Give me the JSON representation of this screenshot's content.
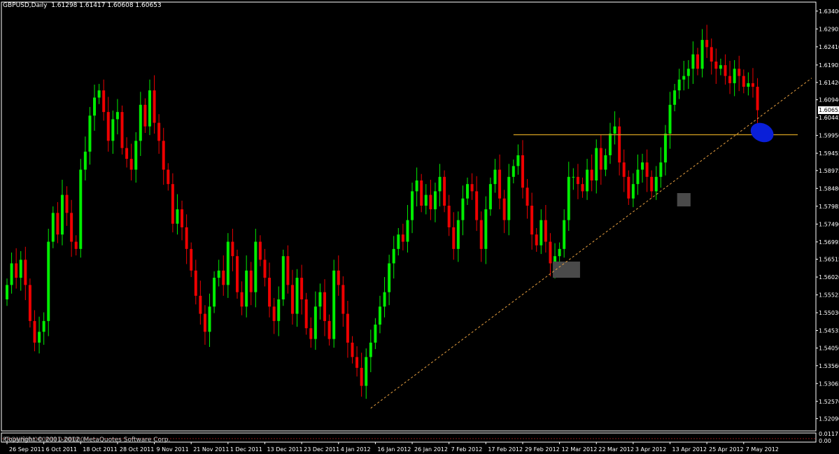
{
  "header": {
    "symbol": "GBPUSD,Daily",
    "ohlc": "1.61298 1.61417 1.60608 1.60653"
  },
  "subwindow": {
    "label": "Copyright © 2001-2012, MetaQuotes Software Corp.",
    "ghost_label": "PRONN(0.00003) 0.00000",
    "axis_top": "0.0117",
    "axis_bottom": "0.00"
  },
  "colors": {
    "background": "#000000",
    "bull": "#00ee00",
    "bear": "#ee0000",
    "axis": "#ffffff",
    "support_line": "#c8961e",
    "trend_line": "#e8a040",
    "marker": "#0a1fd8",
    "zone": "#4a4a4a"
  },
  "chart_data": {
    "type": "candlestick",
    "symbol": "GBPUSD",
    "timeframe": "Daily",
    "last_price": "1.60653",
    "ylim": [
      1.5175,
      1.6365
    ],
    "y_ticks": [
      "1.63400",
      "1.62905",
      "1.62410",
      "1.61905",
      "1.61420",
      "1.60940",
      "1.60445",
      "1.59950",
      "1.59455",
      "1.58975",
      "1.58480",
      "1.57985",
      "1.57490",
      "1.56995",
      "1.56515",
      "1.56020",
      "1.55525",
      "1.55030",
      "1.54535",
      "1.54050",
      "1.53560",
      "1.53065",
      "1.52570",
      "1.52090"
    ],
    "x_ticks": [
      {
        "label": "26 Sep 2011",
        "index": 0
      },
      {
        "label": "6 Oct 2011",
        "index": 8
      },
      {
        "label": "18 Oct 2011",
        "index": 16
      },
      {
        "label": "28 Oct 2011",
        "index": 24
      },
      {
        "label": "9 Nov 2011",
        "index": 32
      },
      {
        "label": "21 Nov 2011",
        "index": 40
      },
      {
        "label": "1 Dec 2011",
        "index": 48
      },
      {
        "label": "13 Dec 2011",
        "index": 56
      },
      {
        "label": "23 Dec 2011",
        "index": 64
      },
      {
        "label": "4 Jan 2012",
        "index": 72
      },
      {
        "label": "16 Jan 2012",
        "index": 80
      },
      {
        "label": "26 Jan 2012",
        "index": 88
      },
      {
        "label": "7 Feb 2012",
        "index": 96
      },
      {
        "label": "17 Feb 2012",
        "index": 104
      },
      {
        "label": "29 Feb 2012",
        "index": 112
      },
      {
        "label": "12 Mar 2012",
        "index": 120
      },
      {
        "label": "22 Mar 2012",
        "index": 128
      },
      {
        "label": "3 Apr 2012",
        "index": 136
      },
      {
        "label": "13 Apr 2012",
        "index": 144
      },
      {
        "label": "25 Apr 2012",
        "index": 152
      },
      {
        "label": "7 May 2012",
        "index": 160
      }
    ],
    "closes": [
      1.558,
      1.564,
      1.56,
      1.565,
      1.558,
      1.548,
      1.542,
      1.545,
      1.548,
      1.57,
      1.578,
      1.572,
      1.583,
      1.578,
      1.57,
      1.568,
      1.59,
      1.595,
      1.605,
      1.61,
      1.612,
      1.606,
      1.598,
      1.604,
      1.606,
      1.596,
      1.593,
      1.59,
      1.598,
      1.608,
      1.602,
      1.612,
      1.603,
      1.598,
      1.59,
      1.586,
      1.575,
      1.579,
      1.574,
      1.568,
      1.562,
      1.555,
      1.55,
      1.545,
      1.552,
      1.56,
      1.562,
      1.558,
      1.57,
      1.566,
      1.556,
      1.552,
      1.562,
      1.556,
      1.57,
      1.565,
      1.56,
      1.552,
      1.548,
      1.554,
      1.566,
      1.558,
      1.55,
      1.56,
      1.554,
      1.546,
      1.543,
      1.552,
      1.556,
      1.548,
      1.543,
      1.562,
      1.558,
      1.55,
      1.542,
      1.538,
      1.535,
      1.53,
      1.538,
      1.542,
      1.547,
      1.552,
      1.556,
      1.564,
      1.568,
      1.572,
      1.57,
      1.576,
      1.584,
      1.587,
      1.58,
      1.583,
      1.579,
      1.584,
      1.588,
      1.58,
      1.574,
      1.568,
      1.576,
      1.582,
      1.586,
      1.584,
      1.576,
      1.568,
      1.579,
      1.586,
      1.59,
      1.582,
      1.576,
      1.588,
      1.591,
      1.594,
      1.585,
      1.58,
      1.572,
      1.569,
      1.576,
      1.57,
      1.564,
      1.566,
      1.568,
      1.576,
      1.588,
      1.588,
      1.586,
      1.584,
      1.59,
      1.587,
      1.596,
      1.59,
      1.594,
      1.6,
      1.602,
      1.592,
      1.588,
      1.582,
      1.586,
      1.59,
      1.592,
      1.588,
      1.584,
      1.588,
      1.592,
      1.6,
      1.608,
      1.612,
      1.615,
      1.616,
      1.618,
      1.622,
      1.618,
      1.626,
      1.624,
      1.62,
      1.618,
      1.619,
      1.616,
      1.614,
      1.618,
      1.616,
      1.613,
      1.614,
      1.613,
      1.6065
    ],
    "annotations": {
      "support_level": 1.5997,
      "support_from_index": 110,
      "trend_line": [
        {
          "index": 79,
          "price": 1.5238
        },
        {
          "index": 171,
          "price": 1.6118
        }
      ],
      "marker": {
        "index": 164,
        "price": 1.6003
      },
      "zones": [
        {
          "from_index": 119,
          "to_index": 124,
          "low": 1.56,
          "high": 1.5645
        },
        {
          "from_index": 146,
          "to_index": 148,
          "low": 1.5798,
          "high": 1.5835
        }
      ]
    }
  }
}
